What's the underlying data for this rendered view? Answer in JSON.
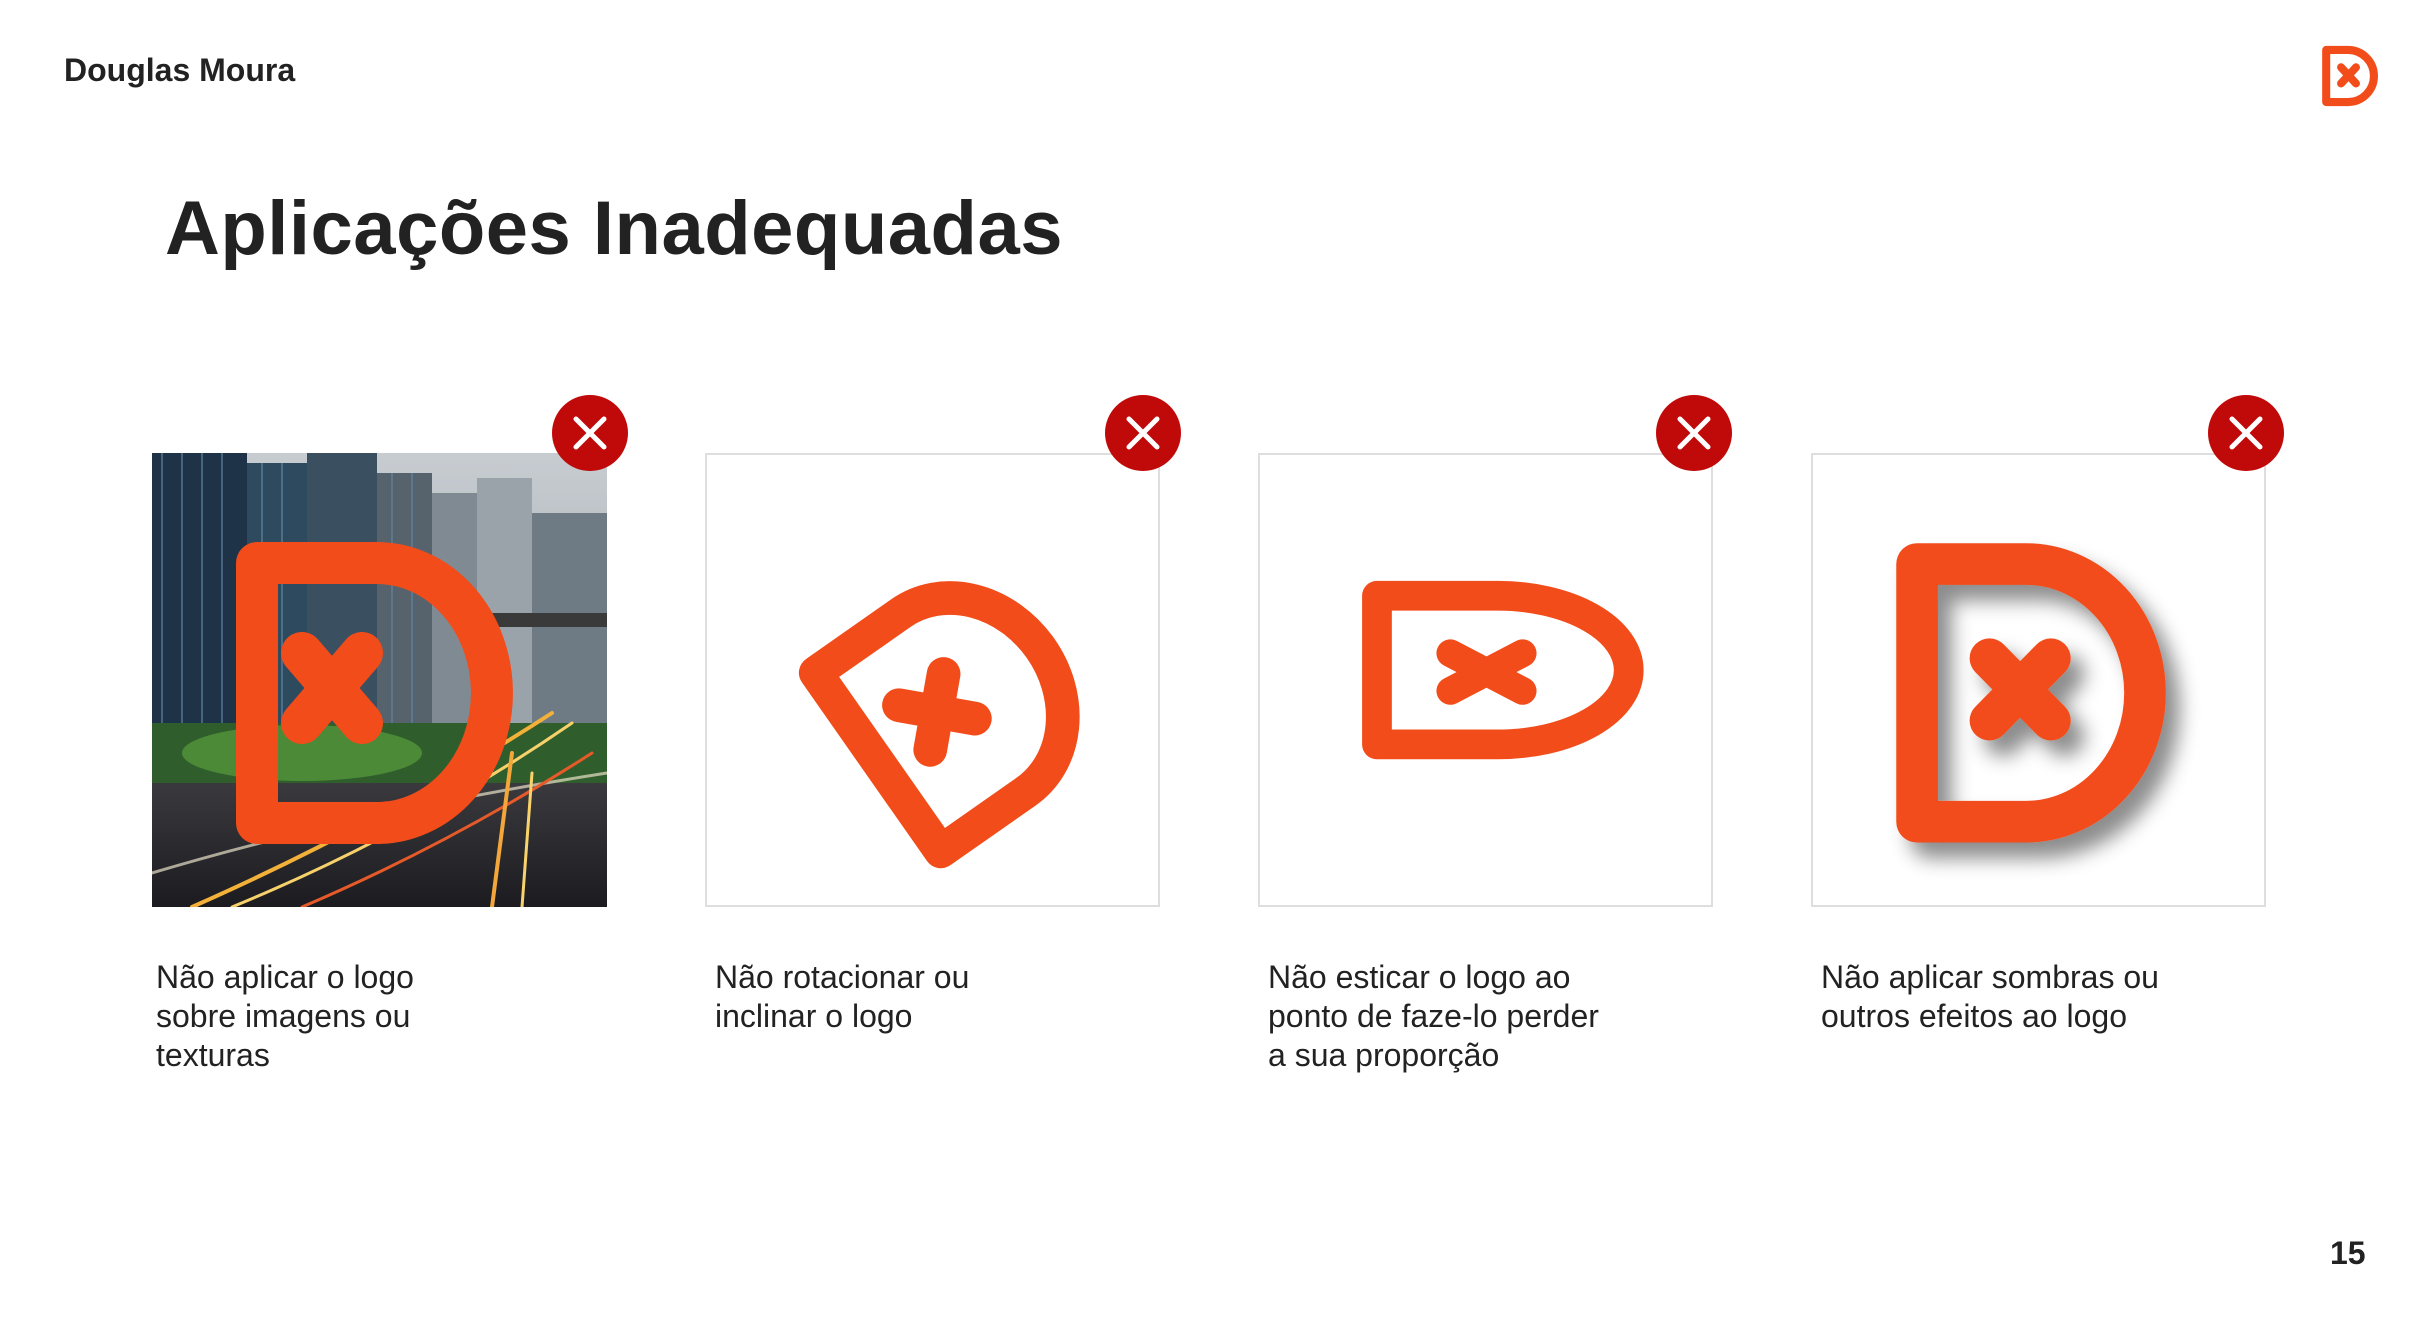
{
  "header": {
    "brand_name": "Douglas Moura"
  },
  "title": "Aplicações Inadequadas",
  "colors": {
    "logo_orange": "#F24C1A",
    "error_red": "#C00A0A",
    "text": "#222222"
  },
  "examples": [
    {
      "caption": "Não aplicar o logo\nsobre imagens ou\ntexturas",
      "badge_icon": "close-icon"
    },
    {
      "caption": "Não rotacionar ou\ninclinar o logo",
      "badge_icon": "close-icon"
    },
    {
      "caption": "Não esticar o logo ao\nponto de faze-lo perder\na sua proporção",
      "badge_icon": "close-icon"
    },
    {
      "caption": "Não aplicar sombras ou\noutros efeitos ao logo",
      "badge_icon": "close-icon"
    }
  ],
  "page_number": "15"
}
